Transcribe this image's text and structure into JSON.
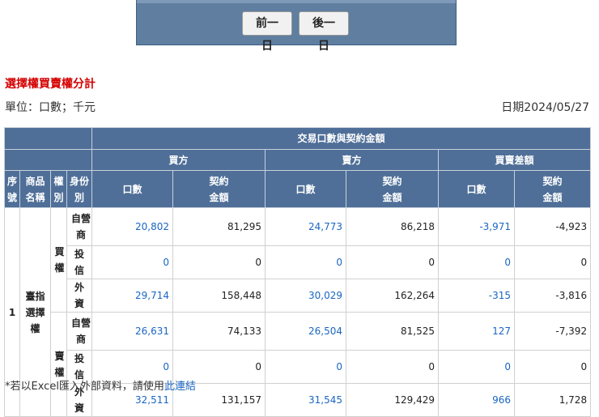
{
  "nav": {
    "prev_label": "前一日",
    "next_label": "後一日"
  },
  "section_title": "選擇權買賣權分計",
  "unit_label": "單位：口數；千元",
  "date_label": "日期2024/05/27",
  "table": {
    "group_header": "交易口數與契約金額",
    "side_headers": [
      "買方",
      "賣方",
      "買賣差額"
    ],
    "col_seq": "序號",
    "col_product": "商品名稱",
    "col_right": "權別",
    "col_identity": "身份別",
    "col_volume": "口數",
    "col_value": "契約金額",
    "seq": "1",
    "product": "臺指選擇權",
    "rights": [
      "買權",
      "賣權"
    ],
    "rows": [
      {
        "identity": "自營商",
        "buy_vol": "20,802",
        "buy_val": "81,295",
        "sell_vol": "24,773",
        "sell_val": "86,218",
        "net_vol": "-3,971",
        "net_val": "-4,923"
      },
      {
        "identity": "投信",
        "buy_vol": "0",
        "buy_val": "0",
        "sell_vol": "0",
        "sell_val": "0",
        "net_vol": "0",
        "net_val": "0"
      },
      {
        "identity": "外資",
        "buy_vol": "29,714",
        "buy_val": "158,448",
        "sell_vol": "30,029",
        "sell_val": "162,264",
        "net_vol": "-315",
        "net_val": "-3,816"
      },
      {
        "identity": "自營商",
        "buy_vol": "26,631",
        "buy_val": "74,133",
        "sell_vol": "26,504",
        "sell_val": "81,525",
        "net_vol": "127",
        "net_val": "-7,392"
      },
      {
        "identity": "投信",
        "buy_vol": "0",
        "buy_val": "0",
        "sell_vol": "0",
        "sell_val": "0",
        "net_vol": "0",
        "net_val": "0"
      },
      {
        "identity": "外資",
        "buy_vol": "32,511",
        "buy_val": "131,157",
        "sell_vol": "31,545",
        "sell_val": "129,429",
        "net_vol": "966",
        "net_val": "1,728"
      }
    ]
  },
  "footnote": {
    "text": "*若以Excel匯入外部資料，請使用",
    "link": "此連結"
  },
  "colors": {
    "header_bg": "#4f6f98",
    "nav_bg": "#5f7ea0",
    "title_red": "#d40000",
    "link_blue": "#1a66c2"
  }
}
